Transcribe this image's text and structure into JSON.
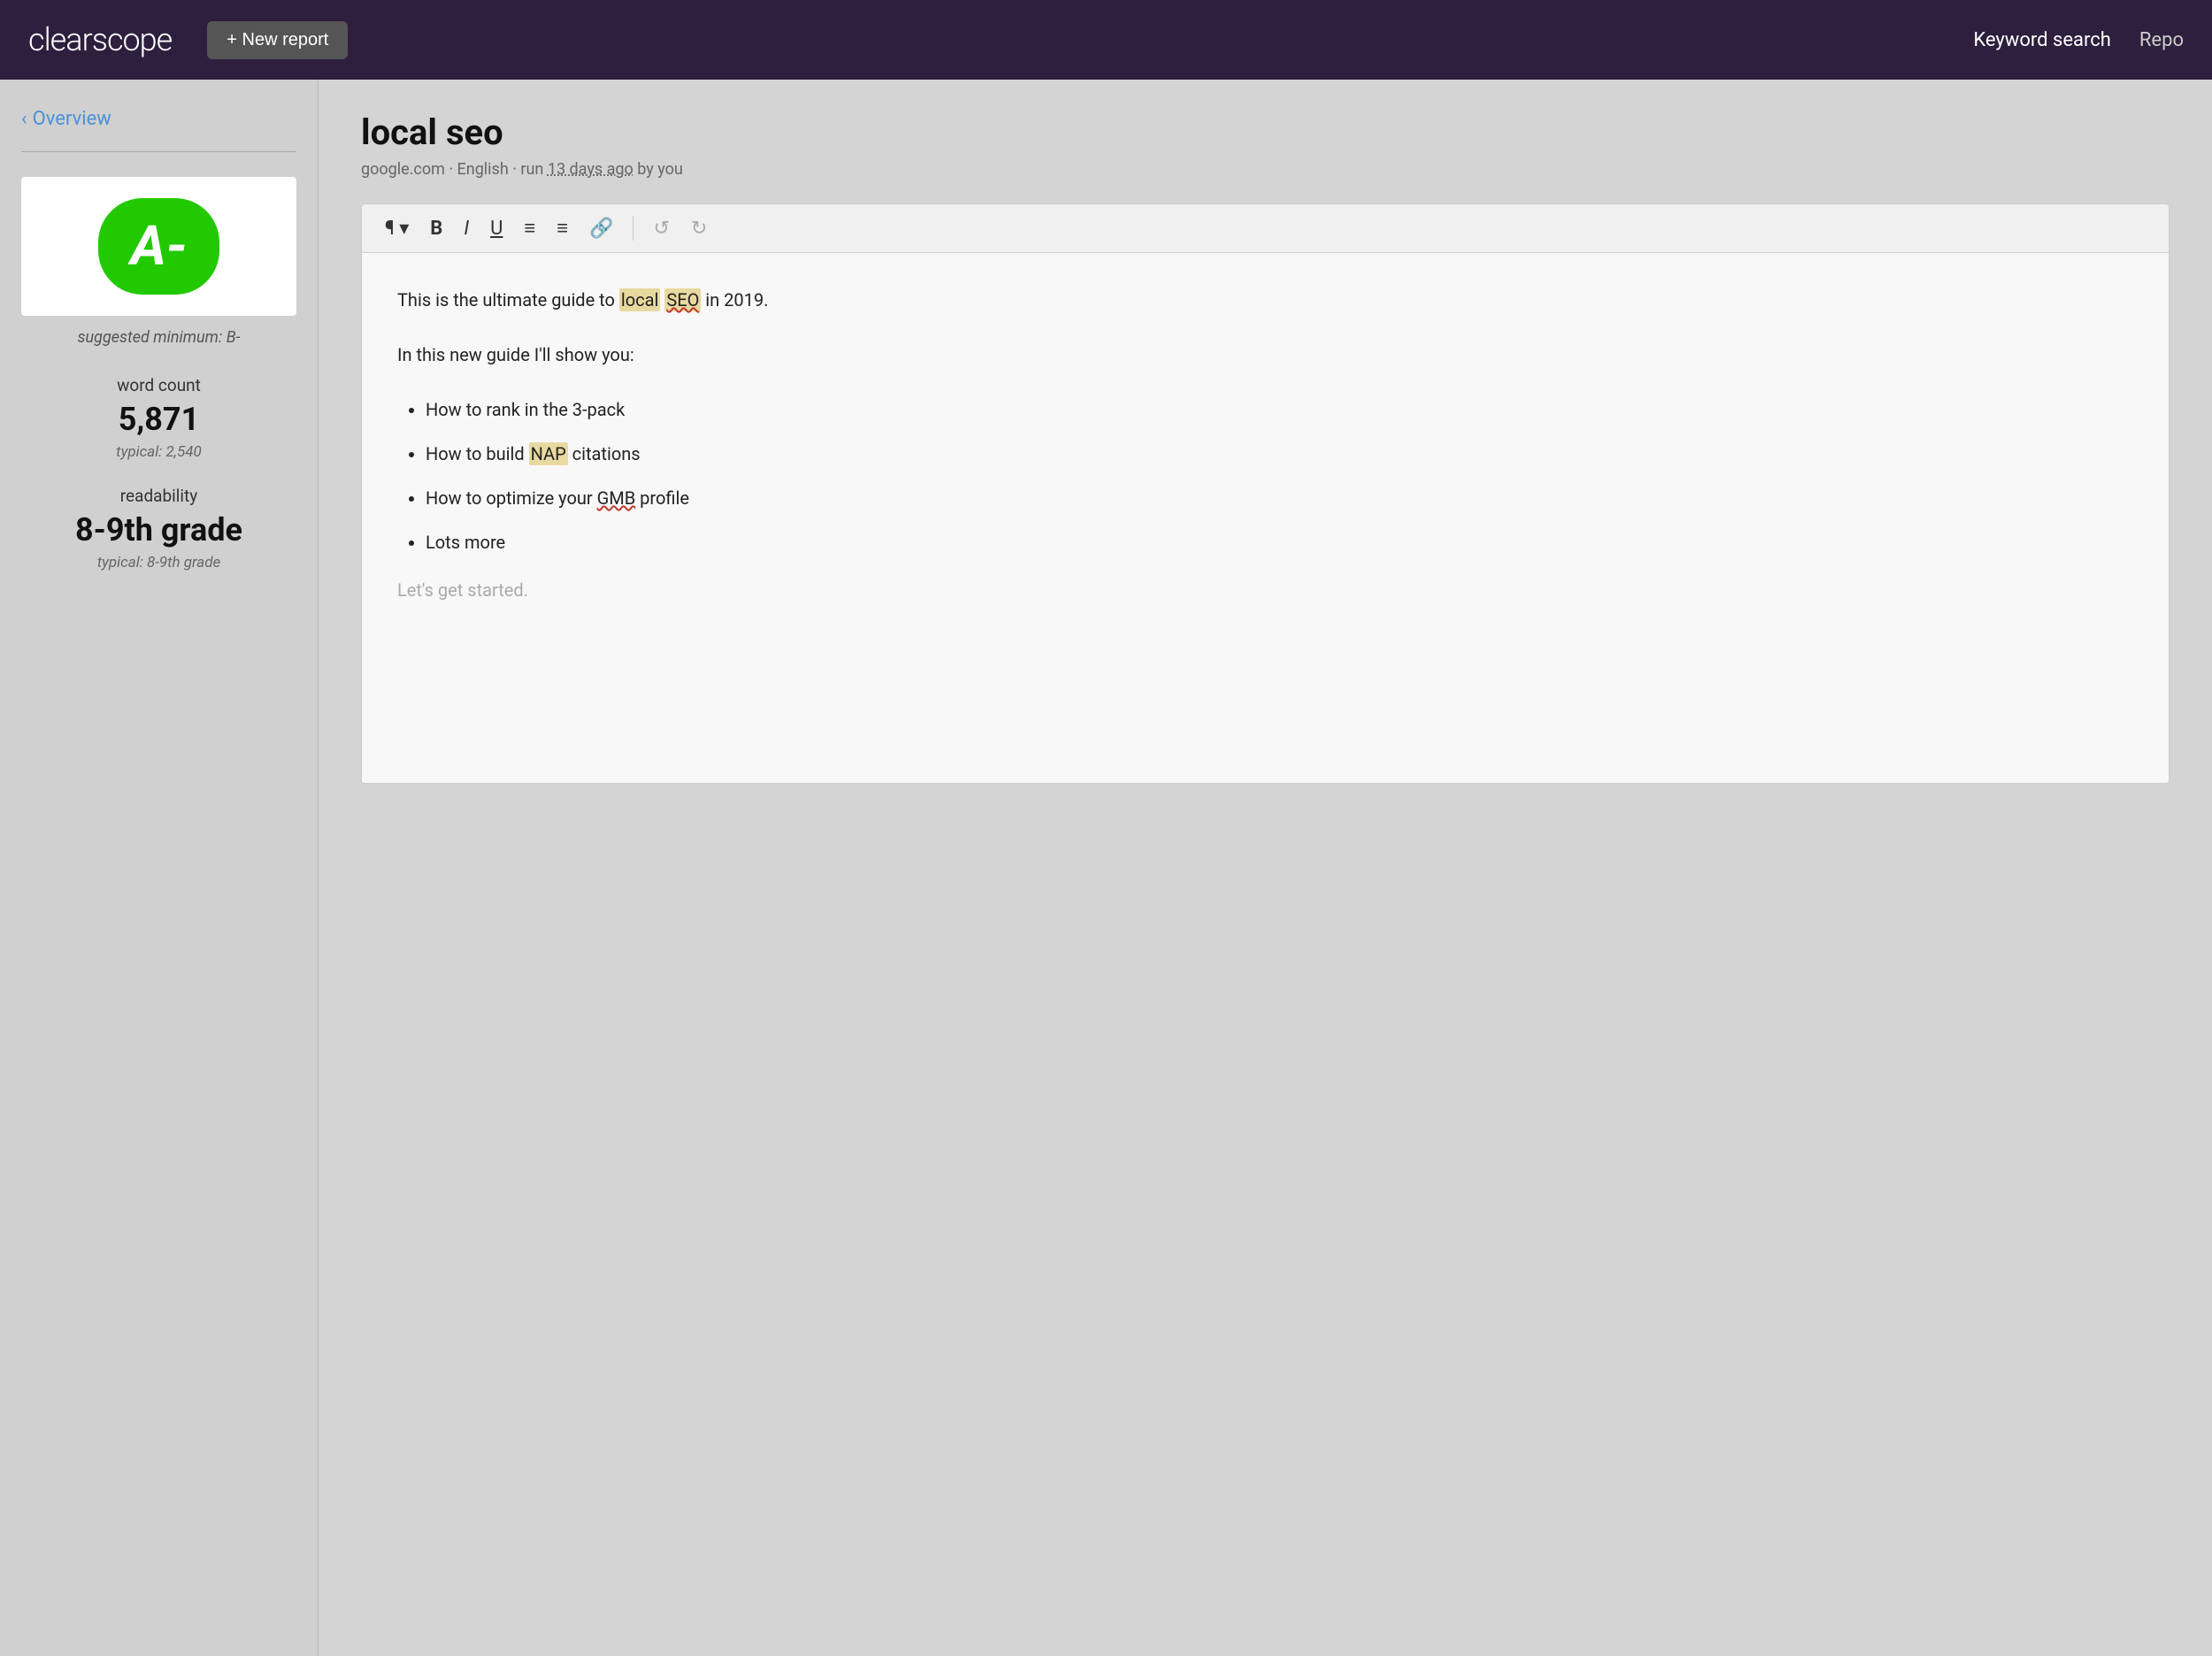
{
  "topnav": {
    "logo": "clearscope",
    "new_report_label": "+ New report",
    "nav_links": [
      {
        "label": "Keyword search",
        "active": true
      },
      {
        "label": "Repo",
        "active": false
      }
    ]
  },
  "sidebar": {
    "overview_label": "Overview",
    "grade": "A-",
    "suggested_min_label": "suggested minimum: B-",
    "word_count_label": "word count",
    "word_count_value": "5,871",
    "word_count_typical": "typical: 2,540",
    "readability_label": "readability",
    "readability_value": "8-9th grade",
    "readability_typical": "typical: 8-9th grade"
  },
  "report": {
    "title": "local seo",
    "meta": "google.com · English · run 13 days ago by you"
  },
  "toolbar": {
    "paragraph_label": "¶",
    "bold_label": "B",
    "italic_label": "I",
    "underline_label": "U",
    "ordered_list_label": "≡",
    "unordered_list_label": "☰",
    "link_label": "🔗",
    "undo_label": "↺",
    "redo_label": "↻"
  },
  "editor": {
    "para1": {
      "before": "This is the ultimate guide to ",
      "highlight1": "local",
      "highlight2": "SEO",
      "after": " in 2019."
    },
    "para2": "In this new guide I'll show you:",
    "list_items": [
      {
        "text": "How to rank in the 3-pack",
        "highlight": null
      },
      {
        "text_before": "How to build ",
        "highlight": "NAP",
        "text_after": " citations"
      },
      {
        "text_before": "How to optimize your ",
        "highlight": "GMB",
        "text_after": " profile"
      },
      {
        "text": "Lots more",
        "highlight": null
      }
    ],
    "placeholder": "Let's get started."
  }
}
